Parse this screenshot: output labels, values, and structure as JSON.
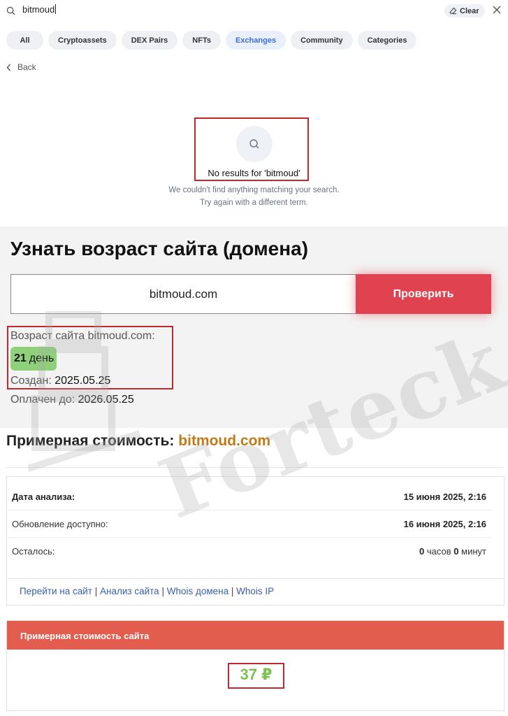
{
  "search": {
    "query": "bitmoud",
    "clear_label": "Clear"
  },
  "filters": [
    "All",
    "Cryptoassets",
    "DEX Pairs",
    "NFTs",
    "Exchanges",
    "Community",
    "Categories"
  ],
  "active_filter": "Exchanges",
  "back_label": "Back",
  "empty_state": {
    "title": "No results for 'bitmoud'",
    "line1": "We couldn't find anything matching your search.",
    "line2": "Try again with a different term."
  },
  "domain_age": {
    "heading": "Узнать возраст сайта (домена)",
    "input_value": "bitmoud.com",
    "check_label": "Проверить",
    "age_label": "Возраст сайта bitmoud.com:",
    "age_value": "21",
    "age_unit": "день",
    "created_label": "Создан:",
    "created_value": "2025.05.25",
    "paid_label": "Оплачен до:",
    "paid_value": "2026.05.25"
  },
  "watermark": "Forteck",
  "price": {
    "title": "Примерная стоимость:",
    "domain": "bitmoud.com",
    "rows": [
      {
        "label": "Дата анализа:",
        "value": "15 июня 2025, 2:16"
      },
      {
        "label": "Обновление доступно:",
        "value": "16 июня 2025, 2:16"
      },
      {
        "label": "Осталось:",
        "value_num1": "0",
        "value_unit1": "часов",
        "value_num2": "0",
        "value_unit2": "минут"
      }
    ],
    "links": [
      "Перейти на сайт",
      "Анализ сайта",
      "Whois домена",
      "Whois IP"
    ],
    "value_header": "Примерная стоимость сайта",
    "value": "37 ₽"
  },
  "colors": {
    "accent_red": "#e0434f",
    "highlight_box": "#c0282d",
    "badge_green": "#8fd17b",
    "value_green": "#7cc14f",
    "domain_orange": "#c07a17",
    "link_blue": "#3a5fa8",
    "active_chip": "#3a6fd8"
  }
}
